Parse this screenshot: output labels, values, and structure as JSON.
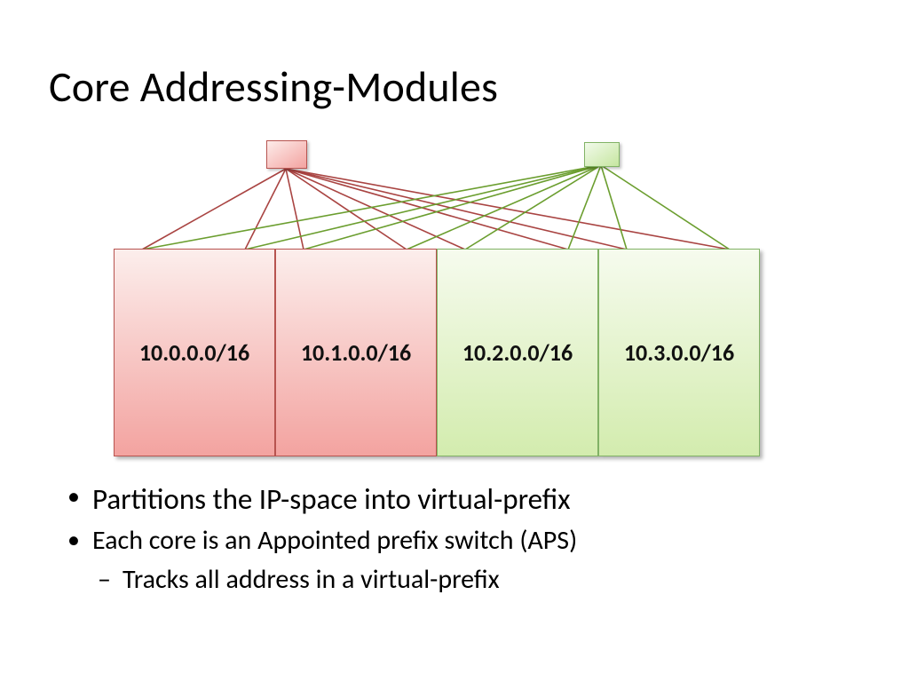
{
  "title": "Core Addressing-Modules",
  "diagram": {
    "top_nodes": [
      {
        "name": "core-red",
        "color": "red"
      },
      {
        "name": "core-green",
        "color": "green"
      }
    ],
    "blocks": [
      {
        "label": "10.0.0.0/16",
        "color": "red"
      },
      {
        "label": "10.1.0.0/16",
        "color": "red"
      },
      {
        "label": "10.2.0.0/16",
        "color": "green"
      },
      {
        "label": "10.3.0.0/16",
        "color": "green"
      }
    ],
    "line_colors": {
      "red": "#a94442",
      "green": "#6b9e2f"
    }
  },
  "bullets": {
    "b1": "Partitions the IP-space into virtual-prefix",
    "b2": "Each core is an Appointed prefix switch (APS)",
    "b2_sub": "Tracks all address in a virtual-prefix"
  }
}
